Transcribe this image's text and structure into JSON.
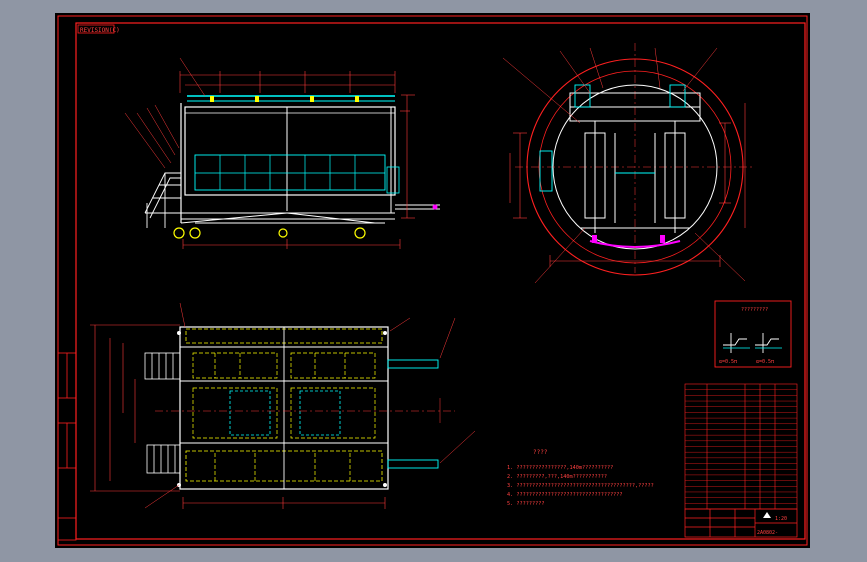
{
  "sheet_label": "REVISION(C)",
  "notes": {
    "heading": "????",
    "lines": [
      "1. ????????????????,140m??????????",
      "2. ?????????,???,140m???????????",
      "3. ??????????????????????????????????????,?????",
      "4. ??????????????????????????????????",
      "5. ?????????"
    ]
  },
  "detail_label": "?????????",
  "detail_captions": [
    "α=0.5π",
    "α=0.5π"
  ],
  "title_block": {
    "drawing_no": "2A0802-",
    "scale": "1:20"
  },
  "colors": {
    "background": "#000000",
    "frame": "#ff0000",
    "outline": "#ffffff",
    "dimension": "#ff3a3a",
    "centerline": "#ff3a3a",
    "hidden": "#ffff00",
    "guard_rail": "#00ffff",
    "highlight": "#ff00ff",
    "shell": "#ff2020"
  }
}
